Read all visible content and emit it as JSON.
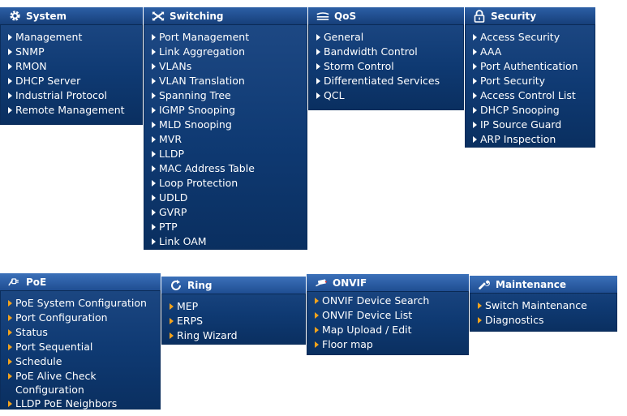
{
  "menus": [
    {
      "id": "system",
      "title": "System",
      "icon": "gear-icon",
      "items": [
        "Management",
        "SNMP",
        "RMON",
        "DHCP Server",
        "Industrial Protocol",
        "Remote Management"
      ]
    },
    {
      "id": "switching",
      "title": "Switching",
      "icon": "crossed-arrows-icon",
      "items": [
        "Port Management",
        "Link Aggregation",
        "VLANs",
        "VLAN Translation",
        "Spanning Tree",
        "IGMP Snooping",
        "MLD Snooping",
        "MVR",
        "LLDP",
        "MAC Address Table",
        "Loop Protection",
        "UDLD",
        "GVRP",
        "PTP",
        "Link OAM"
      ]
    },
    {
      "id": "qos",
      "title": "QoS",
      "icon": "qos-lines-icon",
      "items": [
        "General",
        "Bandwidth Control",
        "Storm Control",
        "Differentiated Services",
        "QCL"
      ]
    },
    {
      "id": "security",
      "title": "Security",
      "icon": "lock-icon",
      "items": [
        "Access Security",
        "AAA",
        "Port Authentication",
        "Port Security",
        "Access Control List",
        "DHCP Snooping",
        "IP Source Guard",
        "ARP Inspection"
      ]
    },
    {
      "id": "poe",
      "title": "PoE",
      "icon": "poe-plug-icon",
      "items": [
        "PoE System Configuration",
        "Port Configuration",
        "Status",
        "Port Sequential",
        "Schedule",
        "PoE Alive Check Configuration",
        "LLDP PoE Neighbors"
      ]
    },
    {
      "id": "ring",
      "title": "Ring",
      "icon": "ring-icon",
      "items": [
        "MEP",
        "ERPS",
        "Ring Wizard"
      ]
    },
    {
      "id": "onvif",
      "title": "ONVIF",
      "icon": "camera-icon",
      "items": [
        "ONVIF Device Search",
        "ONVIF Device List",
        "Map Upload / Edit",
        "Floor map"
      ]
    },
    {
      "id": "maintenance",
      "title": "Maintenance",
      "icon": "wrench-icon",
      "items": [
        "Switch Maintenance",
        "Diagnostics"
      ]
    }
  ],
  "colors": {
    "panel": "#0f3a73",
    "header": "#1f4e92",
    "text": "#ffffff",
    "accent_arrow": "#f3a31c"
  }
}
